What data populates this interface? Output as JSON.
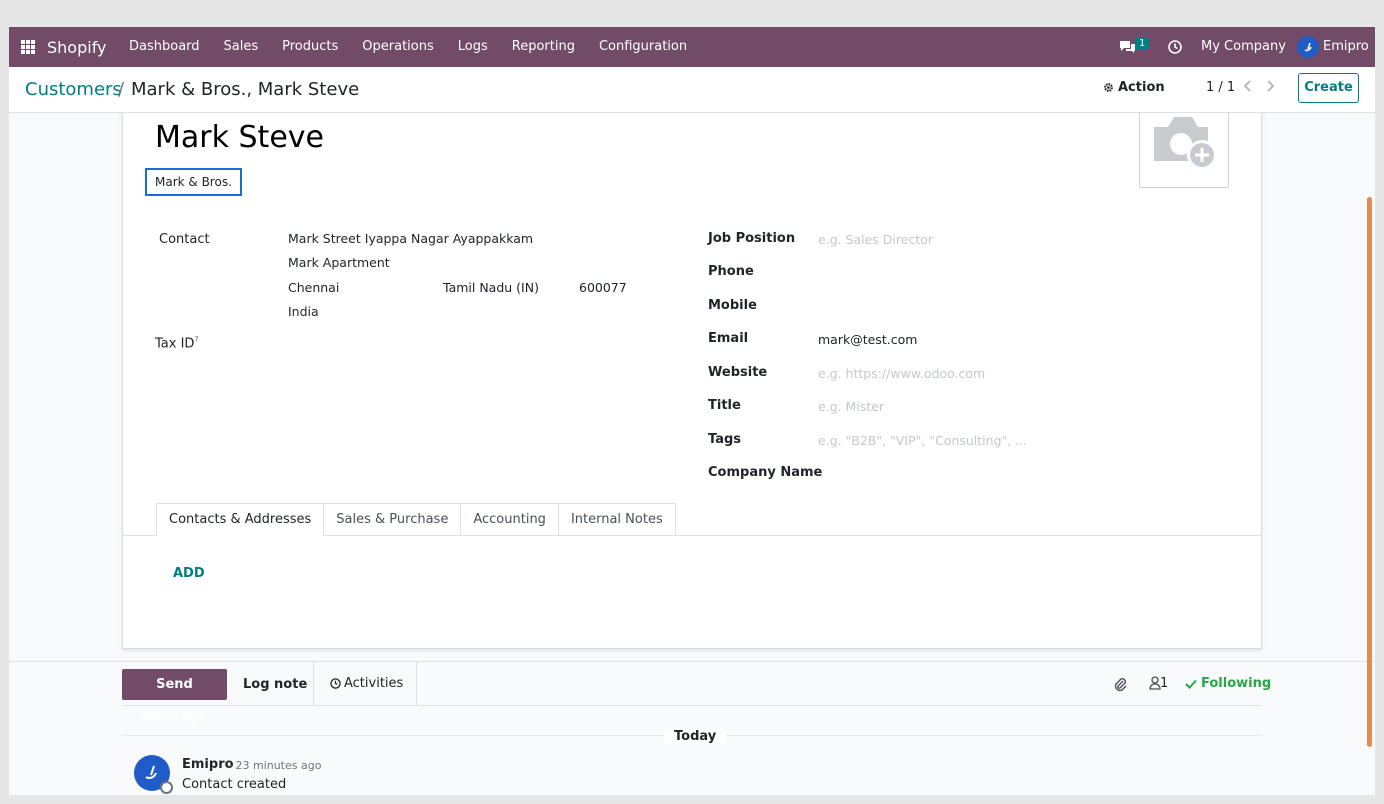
{
  "navbar": {
    "brand": "Shopify",
    "menu": [
      "Dashboard",
      "Sales",
      "Products",
      "Operations",
      "Logs",
      "Reporting",
      "Configuration"
    ],
    "chat_count": "1",
    "company": "My Company",
    "user": "Emipro",
    "color": "#714B67"
  },
  "breadcrumb": {
    "parent": "Customers",
    "separator": "/",
    "current": "Mark & Bros., Mark Steve"
  },
  "control": {
    "action": "Action",
    "pager": "1 / 1",
    "create": "Create"
  },
  "form": {
    "name": "Mark Steve",
    "company": "Mark & Bros.",
    "contact_label": "Contact",
    "address": {
      "street": "Mark Street Iyappa Nagar Ayappakkam",
      "street2": "Mark Apartment",
      "city": "Chennai",
      "state": "Tamil Nadu (IN)",
      "zip": "600077",
      "country": "India"
    },
    "tax_id_label": "Tax ID",
    "tax_help": "?",
    "right_fields": [
      {
        "label": "Job Position",
        "value": "",
        "placeholder": "e.g. Sales Director"
      },
      {
        "label": "Phone",
        "value": "",
        "placeholder": ""
      },
      {
        "label": "Mobile",
        "value": "",
        "placeholder": ""
      },
      {
        "label": "Email",
        "value": "mark@test.com",
        "placeholder": ""
      },
      {
        "label": "Website",
        "value": "",
        "placeholder": "e.g. https://www.odoo.com"
      },
      {
        "label": "Title",
        "value": "",
        "placeholder": "e.g. Mister"
      },
      {
        "label": "Tags",
        "value": "",
        "placeholder": "e.g. \"B2B\", \"VIP\", \"Consulting\", ..."
      },
      {
        "label": "Company Name",
        "value": "",
        "placeholder": ""
      }
    ],
    "tabs": [
      "Contacts & Addresses",
      "Sales & Purchase",
      "Accounting",
      "Internal Notes"
    ],
    "add": "ADD"
  },
  "chatter": {
    "send": "Send message",
    "log": "Log note",
    "activities": "Activities",
    "followers": "1",
    "following": "Following",
    "today": "Today",
    "message": {
      "author": "Emipro",
      "time": "- 23 minutes ago",
      "body": "Contact created"
    }
  }
}
